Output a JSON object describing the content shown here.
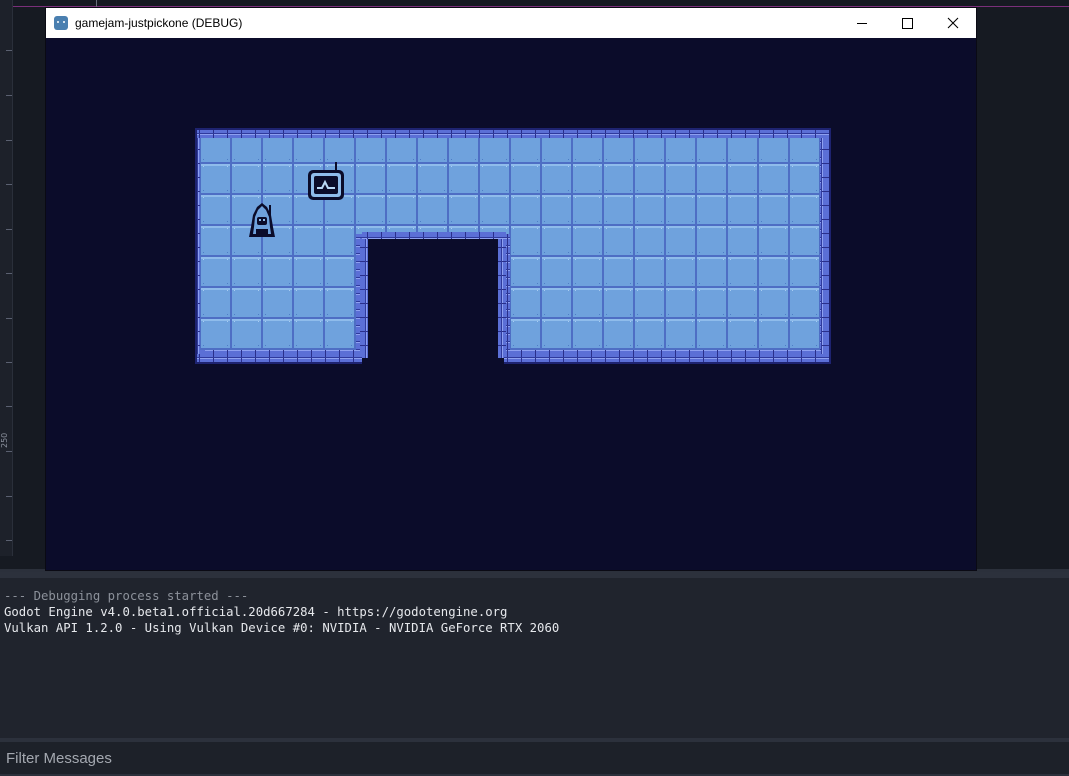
{
  "window": {
    "title": "gamejam-justpickone (DEBUG)",
    "icon": "godot-icon",
    "controls": {
      "minimize": "minimize-icon",
      "maximize": "maximize-icon",
      "close": "close-icon"
    }
  },
  "editor": {
    "ruler_label": "250"
  },
  "game": {
    "background": "#0b0c2a",
    "floor_color": "#6ea0dc",
    "wall_color": "#5a6bd0",
    "entities": [
      {
        "name": "player",
        "icon": "hooded-character-icon"
      },
      {
        "name": "tv-monitor",
        "icon": "tv-monitor-icon"
      }
    ]
  },
  "output": {
    "lines": [
      "--- Debugging process started ---",
      "Godot Engine v4.0.beta1.official.20d667284 - https://godotengine.org",
      "Vulkan API 1.2.0 - Using Vulkan Device #0: NVIDIA - NVIDIA GeForce RTX 2060"
    ]
  },
  "filter": {
    "placeholder": "Filter Messages"
  }
}
